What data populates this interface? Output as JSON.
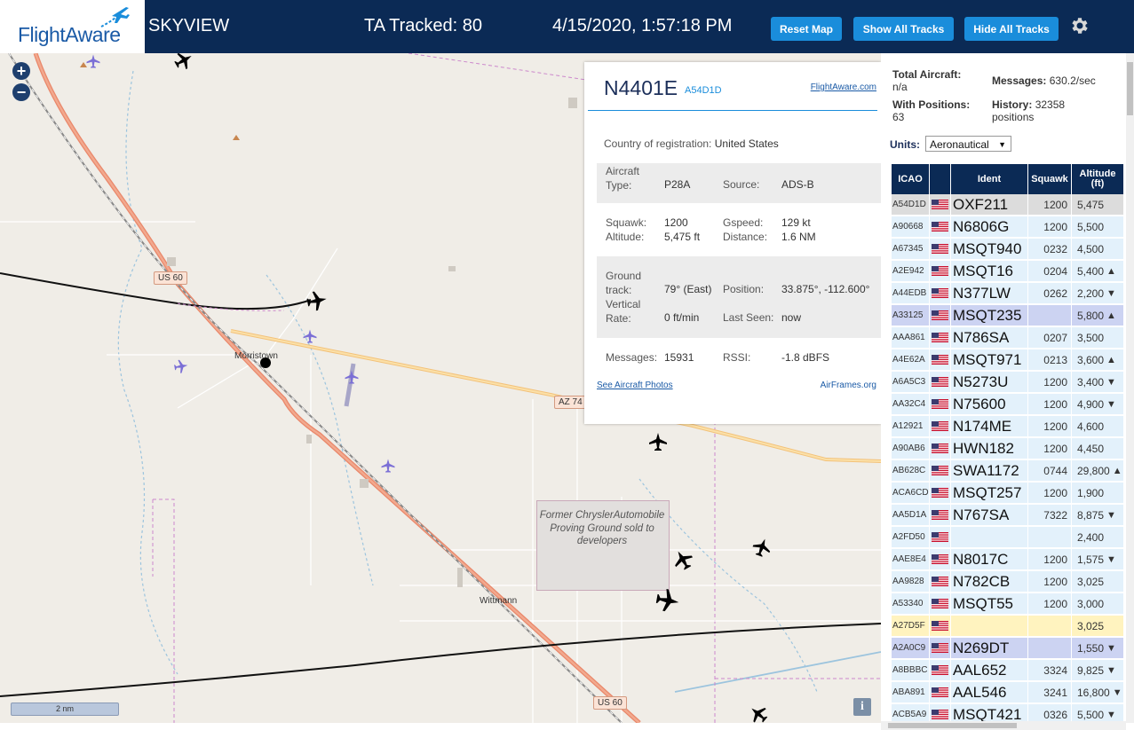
{
  "header": {
    "logo_text": "FlightAware",
    "app_name": "SKYVIEW",
    "tracked_label": "TA Tracked: 80",
    "datetime": "4/15/2020, 1:57:18 PM",
    "buttons": {
      "reset_map": "Reset Map",
      "show_all": "Show All Tracks",
      "hide_all": "Hide All Tracks"
    }
  },
  "map": {
    "zoom_in": "+",
    "zoom_out": "−",
    "labels": {
      "morristown": "Morristown",
      "wittmann": "Wittmann"
    },
    "shields": {
      "us60_top": "US 60",
      "az74": "AZ 74",
      "us60_bottom": "US 60"
    },
    "proving_ground": "Former ChryslerAutomobile Proving Ground sold to developers",
    "scale": "2 nm",
    "info": "i"
  },
  "popup": {
    "ident": "N4401E",
    "hex": "A54D1D",
    "fa_link": "FlightAware.com",
    "country_label": "Country of registration:",
    "country": "United States",
    "aircraft_type_label": "Aircraft Type:",
    "aircraft_type": "P28A",
    "source_label": "Source:",
    "source": "ADS-B",
    "squawk_label": "Squawk:",
    "squawk": "1200",
    "gspeed_label": "Gspeed:",
    "gspeed": "129 kt",
    "altitude_label": "Altitude:",
    "altitude": "5,475 ft",
    "distance_label": "Distance:",
    "distance": "1.6 NM",
    "ground_track_label": "Ground track:",
    "ground_track": "79° (East)",
    "position_label": "Position:",
    "position": "33.875°, -112.600°",
    "vertical_rate_label": "Vertical Rate:",
    "vertical_rate": "0 ft/min",
    "last_seen_label": "Last Seen:",
    "last_seen": "now",
    "messages_label": "Messages:",
    "messages": "15931",
    "rssi_label": "RSSI:",
    "rssi": "-1.8 dBFS",
    "photos_link": "See Aircraft Photos",
    "airframes_link": "AirFrames.org"
  },
  "sidebar": {
    "total_aircraft_label": "Total Aircraft:",
    "total_aircraft": "n/a",
    "messages_label": "Messages:",
    "messages": "630.2/sec",
    "with_positions_label": "With Positions:",
    "with_positions": "63",
    "history_label": "History:",
    "history": "32358",
    "history_unit": "positions",
    "units_label": "Units:",
    "units_value": "Aeronautical",
    "columns": {
      "icao": "ICAO",
      "ident": "Ident",
      "squawk": "Squawk",
      "altitude": "Altitude (ft)"
    },
    "rows": [
      {
        "icao": "A54D1D",
        "ident": "OXF211",
        "squawk": "1200",
        "alt": "5,475",
        "trend": "",
        "bg": "#dcdcdc"
      },
      {
        "icao": "A90668",
        "ident": "N6806G",
        "squawk": "1200",
        "alt": "5,500",
        "trend": "",
        "bg": "#e3f1fb"
      },
      {
        "icao": "A67345",
        "ident": "MSQT940",
        "squawk": "0232",
        "alt": "4,500",
        "trend": "",
        "bg": "#e3f1fb"
      },
      {
        "icao": "A2E942",
        "ident": "MSQT16",
        "squawk": "0204",
        "alt": "5,400",
        "trend": "▲",
        "bg": "#e3f1fb"
      },
      {
        "icao": "A44EDB",
        "ident": "N377LW",
        "squawk": "0262",
        "alt": "2,200",
        "trend": "▼",
        "bg": "#e3f1fb"
      },
      {
        "icao": "A33125",
        "ident": "MSQT235",
        "squawk": "",
        "alt": "5,800",
        "trend": "▲",
        "bg": "#ccd3f2"
      },
      {
        "icao": "AAA861",
        "ident": "N786SA",
        "squawk": "0207",
        "alt": "3,500",
        "trend": "",
        "bg": "#e3f1fb"
      },
      {
        "icao": "A4E62A",
        "ident": "MSQT971",
        "squawk": "0213",
        "alt": "3,600",
        "trend": "▲",
        "bg": "#e3f1fb"
      },
      {
        "icao": "A6A5C3",
        "ident": "N5273U",
        "squawk": "1200",
        "alt": "3,400",
        "trend": "▼",
        "bg": "#e3f1fb"
      },
      {
        "icao": "AA32C4",
        "ident": "N75600",
        "squawk": "1200",
        "alt": "4,900",
        "trend": "▼",
        "bg": "#e3f1fb"
      },
      {
        "icao": "A12921",
        "ident": "N174ME",
        "squawk": "1200",
        "alt": "4,600",
        "trend": "",
        "bg": "#e3f1fb"
      },
      {
        "icao": "A90AB6",
        "ident": "HWN182",
        "squawk": "1200",
        "alt": "4,450",
        "trend": "",
        "bg": "#e3f1fb"
      },
      {
        "icao": "AB628C",
        "ident": "SWA1172",
        "squawk": "0744",
        "alt": "29,800",
        "trend": "▲",
        "bg": "#e3f1fb"
      },
      {
        "icao": "ACA6CD",
        "ident": "MSQT257",
        "squawk": "1200",
        "alt": "1,900",
        "trend": "",
        "bg": "#e3f1fb"
      },
      {
        "icao": "AA5D1A",
        "ident": "N767SA",
        "squawk": "7322",
        "alt": "8,875",
        "trend": "▼",
        "bg": "#e3f1fb"
      },
      {
        "icao": "A2FD50",
        "ident": "",
        "squawk": "",
        "alt": "2,400",
        "trend": "",
        "bg": "#e3f1fb"
      },
      {
        "icao": "AAE8E4",
        "ident": "N8017C",
        "squawk": "1200",
        "alt": "1,575",
        "trend": "▼",
        "bg": "#e3f1fb"
      },
      {
        "icao": "AA9828",
        "ident": "N782CB",
        "squawk": "1200",
        "alt": "3,025",
        "trend": "",
        "bg": "#e3f1fb"
      },
      {
        "icao": "A53340",
        "ident": "MSQT55",
        "squawk": "1200",
        "alt": "3,000",
        "trend": "",
        "bg": "#e3f1fb"
      },
      {
        "icao": "A27D5F",
        "ident": "",
        "squawk": "",
        "alt": "3,025",
        "trend": "",
        "bg": "#fff3bf"
      },
      {
        "icao": "A2A0C9",
        "ident": "N269DT",
        "squawk": "",
        "alt": "1,550",
        "trend": "▼",
        "bg": "#ccd3f2"
      },
      {
        "icao": "A8BBBC",
        "ident": "AAL652",
        "squawk": "3324",
        "alt": "9,825",
        "trend": "▼",
        "bg": "#e3f1fb"
      },
      {
        "icao": "ABA891",
        "ident": "AAL546",
        "squawk": "3241",
        "alt": "16,800",
        "trend": "▼",
        "bg": "#e3f1fb"
      },
      {
        "icao": "ACB5A9",
        "ident": "MSQT421",
        "squawk": "0326",
        "alt": "5,500",
        "trend": "▼",
        "bg": "#e3f1fb"
      }
    ]
  },
  "colors": {
    "header_bg": "#0b2a55",
    "button_bg": "#1a8ddb",
    "link": "#1a5aa6"
  }
}
